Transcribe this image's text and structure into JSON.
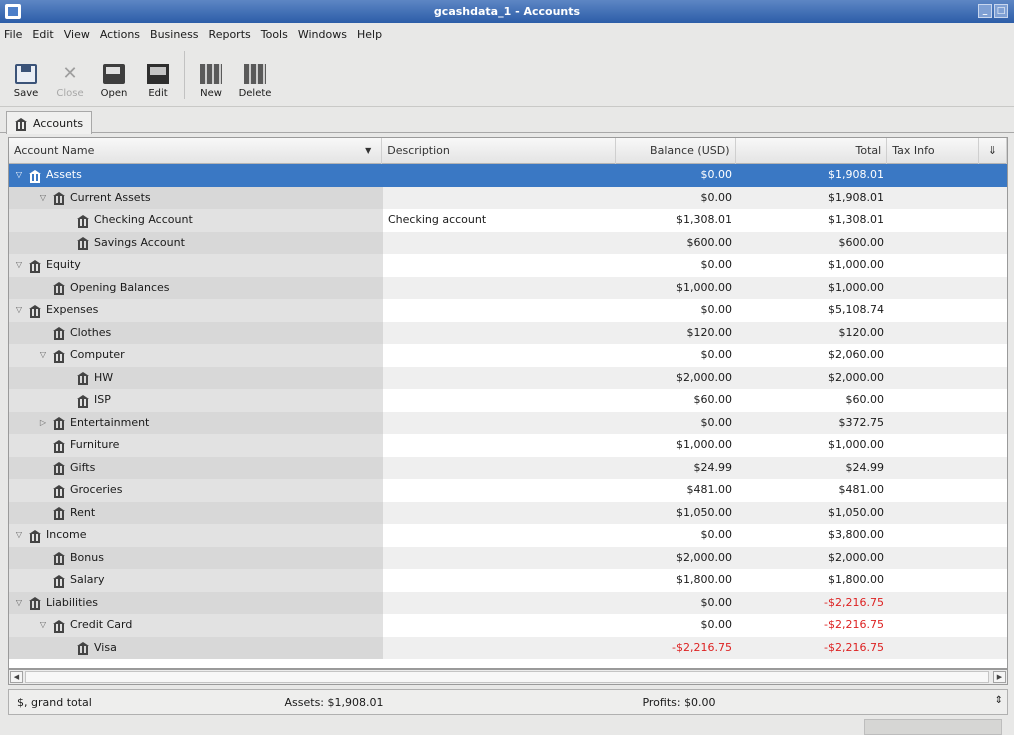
{
  "window": {
    "title": "gcashdata_1 - Accounts"
  },
  "menu": [
    "File",
    "Edit",
    "View",
    "Actions",
    "Business",
    "Reports",
    "Tools",
    "Windows",
    "Help"
  ],
  "toolbar": {
    "save": "Save",
    "close": "Close",
    "open": "Open",
    "edit": "Edit",
    "new": "New",
    "delete": "Delete"
  },
  "tab": {
    "label": "Accounts"
  },
  "columns": {
    "name": "Account Name",
    "description": "Description",
    "balance": "Balance (USD)",
    "total": "Total",
    "tax": "Tax Info"
  },
  "accounts": [
    {
      "name": "Assets",
      "description": "",
      "balance": "$0.00",
      "total": "$1,908.01",
      "level": 0,
      "expander": "open"
    },
    {
      "name": "Current Assets",
      "description": "",
      "balance": "$0.00",
      "total": "$1,908.01",
      "level": 1,
      "expander": "open"
    },
    {
      "name": "Checking Account",
      "description": "Checking account",
      "balance": "$1,308.01",
      "total": "$1,308.01",
      "level": 2,
      "expander": "none"
    },
    {
      "name": "Savings Account",
      "description": "",
      "balance": "$600.00",
      "total": "$600.00",
      "level": 2,
      "expander": "none"
    },
    {
      "name": "Equity",
      "description": "",
      "balance": "$0.00",
      "total": "$1,000.00",
      "level": 0,
      "expander": "open"
    },
    {
      "name": "Opening Balances",
      "description": "",
      "balance": "$1,000.00",
      "total": "$1,000.00",
      "level": 1,
      "expander": "none"
    },
    {
      "name": "Expenses",
      "description": "",
      "balance": "$0.00",
      "total": "$5,108.74",
      "level": 0,
      "expander": "open"
    },
    {
      "name": "Clothes",
      "description": "",
      "balance": "$120.00",
      "total": "$120.00",
      "level": 1,
      "expander": "none"
    },
    {
      "name": "Computer",
      "description": "",
      "balance": "$0.00",
      "total": "$2,060.00",
      "level": 1,
      "expander": "open"
    },
    {
      "name": "HW",
      "description": "",
      "balance": "$2,000.00",
      "total": "$2,000.00",
      "level": 2,
      "expander": "none"
    },
    {
      "name": "ISP",
      "description": "",
      "balance": "$60.00",
      "total": "$60.00",
      "level": 2,
      "expander": "none"
    },
    {
      "name": "Entertainment",
      "description": "",
      "balance": "$0.00",
      "total": "$372.75",
      "level": 1,
      "expander": "closed"
    },
    {
      "name": "Furniture",
      "description": "",
      "balance": "$1,000.00",
      "total": "$1,000.00",
      "level": 1,
      "expander": "none"
    },
    {
      "name": "Gifts",
      "description": "",
      "balance": "$24.99",
      "total": "$24.99",
      "level": 1,
      "expander": "none"
    },
    {
      "name": "Groceries",
      "description": "",
      "balance": "$481.00",
      "total": "$481.00",
      "level": 1,
      "expander": "none"
    },
    {
      "name": "Rent",
      "description": "",
      "balance": "$1,050.00",
      "total": "$1,050.00",
      "level": 1,
      "expander": "none"
    },
    {
      "name": "Income",
      "description": "",
      "balance": "$0.00",
      "total": "$3,800.00",
      "level": 0,
      "expander": "open"
    },
    {
      "name": "Bonus",
      "description": "",
      "balance": "$2,000.00",
      "total": "$2,000.00",
      "level": 1,
      "expander": "none"
    },
    {
      "name": "Salary",
      "description": "",
      "balance": "$1,800.00",
      "total": "$1,800.00",
      "level": 1,
      "expander": "none"
    },
    {
      "name": "Liabilities",
      "description": "",
      "balance": "$0.00",
      "total": "-$2,216.75",
      "level": 0,
      "expander": "open"
    },
    {
      "name": "Credit Card",
      "description": "",
      "balance": "$0.00",
      "total": "-$2,216.75",
      "level": 1,
      "expander": "open"
    },
    {
      "name": "Visa",
      "description": "",
      "balance": "-$2,216.75",
      "total": "-$2,216.75",
      "level": 2,
      "expander": "none"
    }
  ],
  "selected_index": 0,
  "summary": {
    "selector": "$, grand total",
    "assets": "Assets: $1,908.01",
    "profits": "Profits: $0.00"
  },
  "colors": {
    "selection": "#3a78c4",
    "negative": "#dd2222",
    "titlebar": "#2c5da8"
  }
}
